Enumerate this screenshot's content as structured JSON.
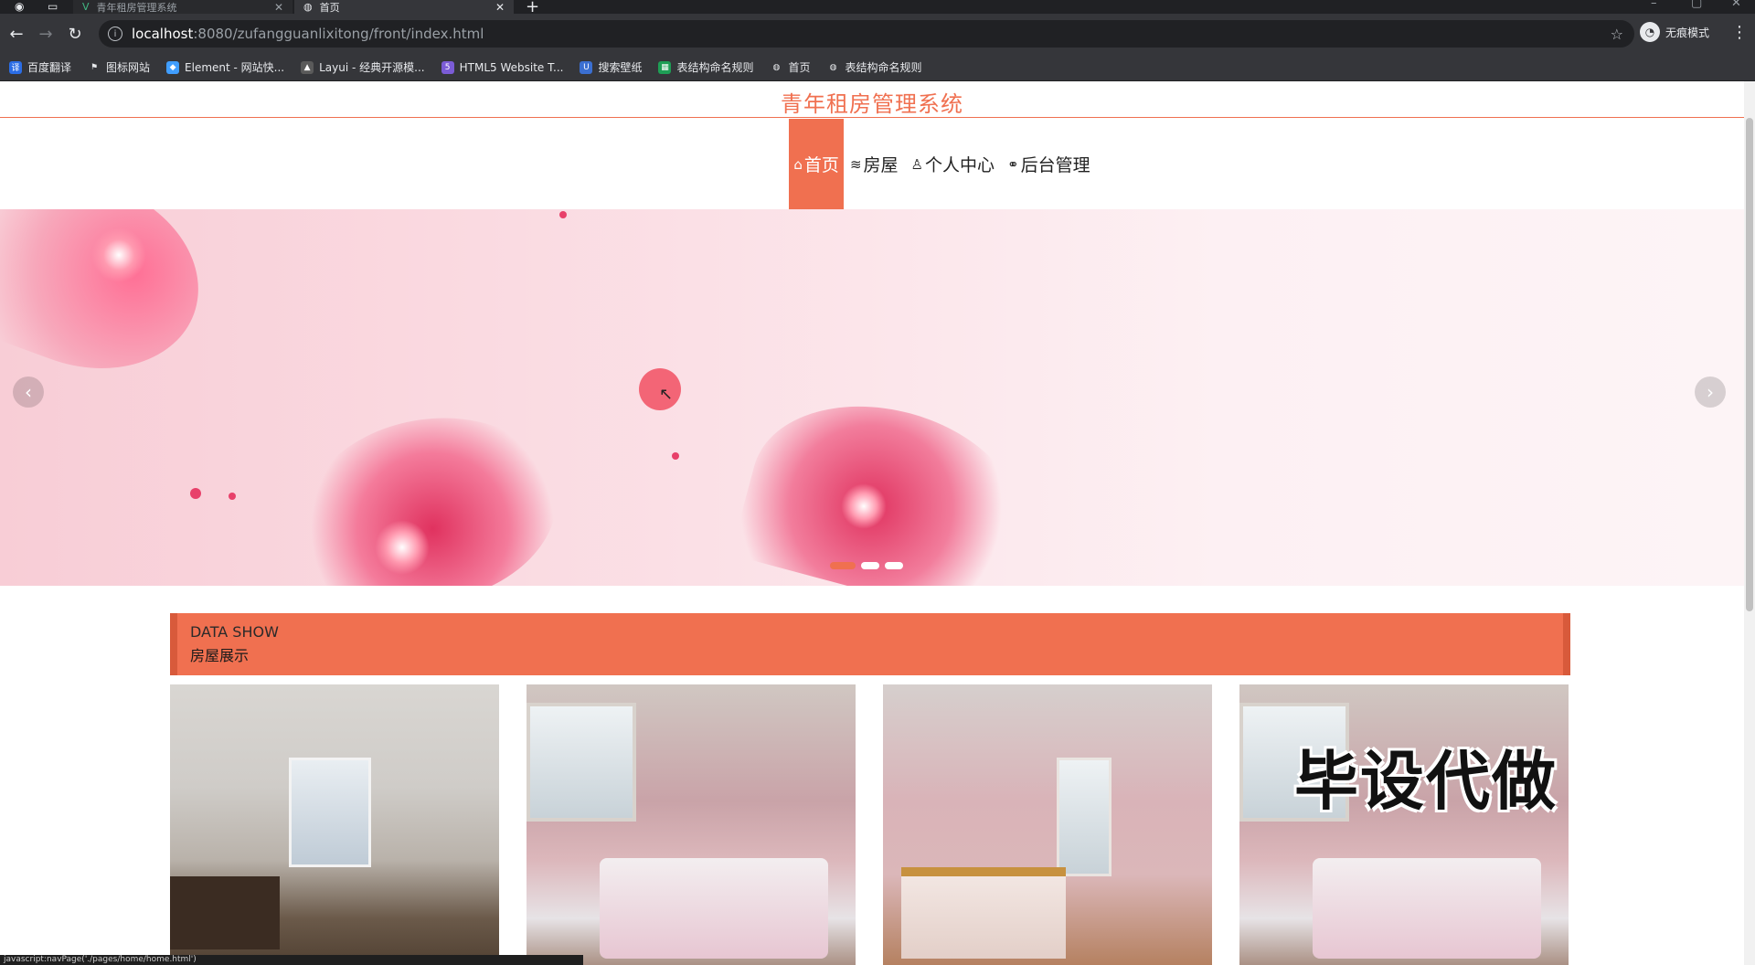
{
  "browser": {
    "tabs": [
      {
        "title": "青年租房管理系统",
        "active": false
      },
      {
        "title": "首页",
        "active": true
      }
    ],
    "new_tab": "+",
    "url_host": "localhost",
    "url_path": ":8080/zufangguanlixitong/front/index.html",
    "profile_label": "无痕模式",
    "bookmarks": [
      {
        "label": "百度翻译",
        "icon": "translate-icon",
        "color": "#2b6de5"
      },
      {
        "label": "图标网站",
        "icon": "flag-icon",
        "color": "#e8eaed"
      },
      {
        "label": "Element - 网站快...",
        "icon": "element-icon",
        "color": "#409eff"
      },
      {
        "label": "Layui - 经典开源模...",
        "icon": "layui-icon",
        "color": "#5a5a5a"
      },
      {
        "label": "HTML5 Website T...",
        "icon": "html5-icon",
        "color": "#7b5cd6"
      },
      {
        "label": "搜索壁纸",
        "icon": "wallpaper-icon",
        "color": "#3b6fd1"
      },
      {
        "label": "表结构命名规则",
        "icon": "table-icon",
        "color": "#1e9e55"
      },
      {
        "label": "首页",
        "icon": "globe-icon",
        "color": "#e8eaed"
      },
      {
        "label": "表结构命名规则",
        "icon": "globe-icon",
        "color": "#e8eaed"
      }
    ]
  },
  "site": {
    "title": "青年租房管理系统",
    "accent": "#f07050",
    "nav": [
      {
        "label": "首页",
        "icon": "home-icon",
        "glyph": "⌂",
        "active": true
      },
      {
        "label": "房屋",
        "icon": "layers-icon",
        "glyph": "≋",
        "active": false
      },
      {
        "label": "个人中心",
        "icon": "user-icon",
        "glyph": "♙",
        "active": false
      },
      {
        "label": "后台管理",
        "icon": "link-icon",
        "glyph": "⚭",
        "active": false
      }
    ]
  },
  "banner": {
    "indicator_count": 3,
    "active_index": 0
  },
  "section": {
    "en": "DATA SHOW",
    "zh": "房屋展示"
  },
  "cards": {
    "watermark": "毕设代做"
  },
  "status_text": "javascript:navPage('./pages/home/home.html')"
}
